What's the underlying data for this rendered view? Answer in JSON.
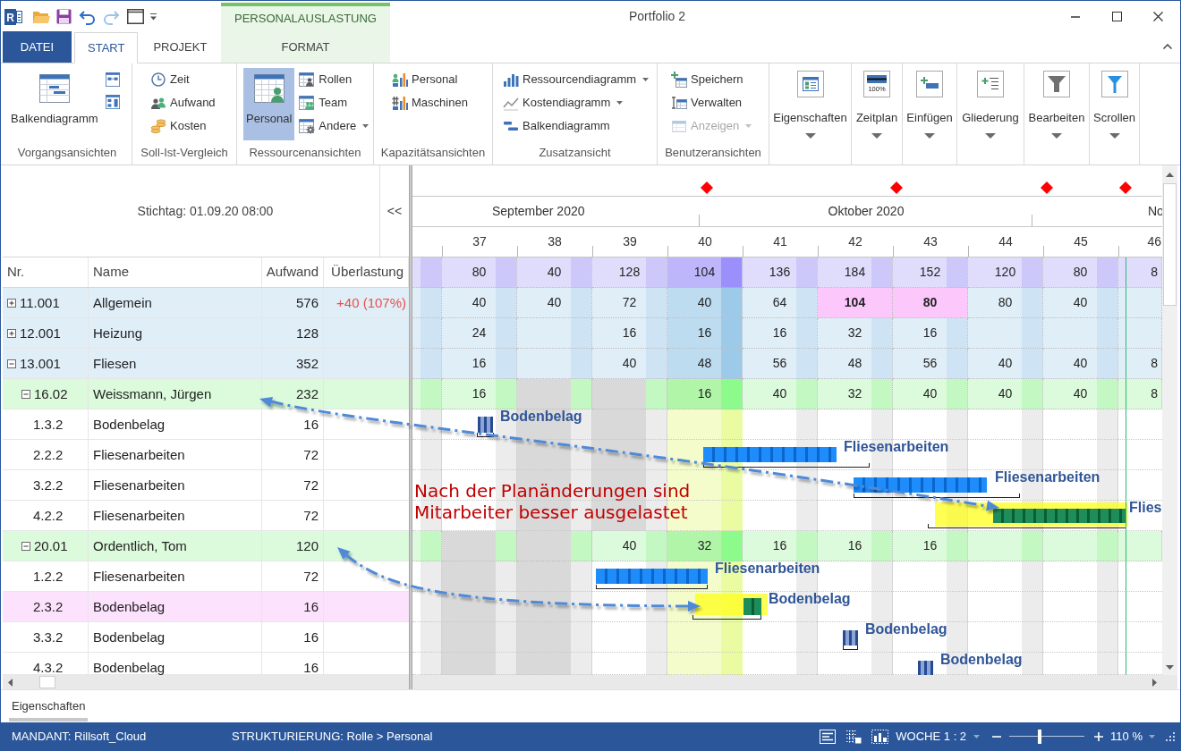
{
  "window": {
    "title": "Portfolio 2",
    "logo_letter": "R"
  },
  "context_tab": {
    "label": "PERSONALAUSLASTUNG"
  },
  "tabs": [
    {
      "label": "DATEI",
      "kind": "file",
      "selected": false
    },
    {
      "label": "START",
      "kind": "tab",
      "selected": true
    },
    {
      "label": "PROJEKT",
      "kind": "tab",
      "selected": false
    },
    {
      "label": "FORMAT",
      "kind": "context",
      "selected": false
    }
  ],
  "ribbon_groups": [
    {
      "label": "Vorgangsansichten",
      "items": [
        {
          "kind": "large",
          "label": "Balkendiagramm",
          "selected": false,
          "disabled": false,
          "dropdown": false
        },
        {
          "kind": "icon",
          "selected": false,
          "disabled": false,
          "dropdown": false
        },
        {
          "kind": "icon",
          "selected": false,
          "disabled": false,
          "dropdown": false
        }
      ]
    },
    {
      "label": "Soll-Ist-Vergleich",
      "items": [
        {
          "kind": "small",
          "label": "Zeit",
          "selected": false,
          "disabled": false,
          "dropdown": false
        },
        {
          "kind": "small",
          "label": "Aufwand",
          "selected": false,
          "disabled": false,
          "dropdown": false
        },
        {
          "kind": "small",
          "label": "Kosten",
          "selected": false,
          "disabled": false,
          "dropdown": false
        }
      ]
    },
    {
      "label": "Ressourcenansichten",
      "items": [
        {
          "kind": "large",
          "label": "Personal",
          "selected": true,
          "disabled": false,
          "dropdown": false
        },
        {
          "kind": "small",
          "label": "Rollen",
          "selected": false,
          "disabled": false,
          "dropdown": false
        },
        {
          "kind": "small",
          "label": "Team",
          "selected": false,
          "disabled": false,
          "dropdown": false
        },
        {
          "kind": "small",
          "label": "Andere",
          "selected": false,
          "disabled": false,
          "dropdown": true
        }
      ]
    },
    {
      "label": "Kapazitätsansichten",
      "items": [
        {
          "kind": "small",
          "label": "Personal",
          "selected": false,
          "disabled": false,
          "dropdown": false
        },
        {
          "kind": "small",
          "label": "Maschinen",
          "selected": false,
          "disabled": false,
          "dropdown": false
        }
      ]
    },
    {
      "label": "Zusatzansicht",
      "items": [
        {
          "kind": "small",
          "label": "Ressourcendiagramm",
          "selected": false,
          "disabled": false,
          "dropdown": true
        },
        {
          "kind": "small",
          "label": "Kostendiagramm",
          "selected": false,
          "disabled": false,
          "dropdown": true
        },
        {
          "kind": "small",
          "label": "Balkendiagramm",
          "selected": false,
          "disabled": false,
          "dropdown": false
        }
      ]
    },
    {
      "label": "Benutzeransichten",
      "items": [
        {
          "kind": "small",
          "label": "Speichern",
          "selected": false,
          "disabled": false,
          "dropdown": false
        },
        {
          "kind": "small",
          "label": "Verwalten",
          "selected": false,
          "disabled": false,
          "dropdown": false
        },
        {
          "kind": "small",
          "label": "Anzeigen",
          "selected": false,
          "disabled": true,
          "dropdown": true
        }
      ]
    }
  ],
  "ribbon_menus": [
    {
      "label": "Eigenschaften"
    },
    {
      "label": "Zeitplan",
      "icon_text": "100%"
    },
    {
      "label": "Einfügen"
    },
    {
      "label": "Gliederung"
    },
    {
      "label": "Bearbeiten"
    },
    {
      "label": "Scrollen"
    }
  ],
  "left_panel": {
    "key_date": "Stichtag: 01.09.20 08:00",
    "collapse_button": "<<"
  },
  "table": {
    "columns": [
      "Nr.",
      "Name",
      "Aufwand",
      "Überlastung"
    ],
    "rows": [
      {
        "kind": "group",
        "nr": "11.001",
        "name": "Allgemein",
        "effort": "576",
        "overload": "+40 (107%)",
        "expanded": false,
        "selected": false,
        "weeks": [
          {
            "hours": "40",
            "overload": false
          },
          {
            "hours": "40",
            "overload": false
          },
          {
            "hours": "72",
            "overload": false
          },
          {
            "hours": "40",
            "overload": false
          },
          {
            "hours": "64",
            "overload": false
          },
          {
            "hours": "104",
            "overload": true
          },
          {
            "hours": "80",
            "overload": true
          },
          {
            "hours": "80",
            "overload": false
          },
          {
            "hours": "40",
            "overload": false
          },
          {
            "overload": false
          }
        ]
      },
      {
        "kind": "group",
        "nr": "12.001",
        "name": "Heizung",
        "effort": "128",
        "expanded": false,
        "selected": false,
        "weeks": [
          {
            "hours": "24",
            "overload": false
          },
          {
            "overload": false
          },
          {
            "hours": "16",
            "overload": false
          },
          {
            "hours": "16",
            "overload": false
          },
          {
            "hours": "16",
            "overload": false
          },
          {
            "hours": "32",
            "overload": false
          },
          {
            "hours": "16",
            "overload": false
          },
          {
            "overload": false
          },
          {
            "overload": false
          },
          {
            "overload": false
          }
        ]
      },
      {
        "kind": "group",
        "nr": "13.001",
        "name": "Fliesen",
        "effort": "352",
        "expanded": true,
        "selected": false,
        "weeks": [
          {
            "hours": "16",
            "overload": false
          },
          {
            "overload": false
          },
          {
            "hours": "40",
            "overload": false
          },
          {
            "hours": "48",
            "overload": false
          },
          {
            "hours": "56",
            "overload": false
          },
          {
            "hours": "48",
            "overload": false
          },
          {
            "hours": "56",
            "overload": false
          },
          {
            "hours": "40",
            "overload": false
          },
          {
            "hours": "40",
            "overload": false
          },
          {
            "hours": "8",
            "overload": false
          }
        ],
        "children": [
          {
            "kind": "person",
            "nr": "16.02",
            "name": "Weissmann, Jürgen",
            "effort": "232",
            "expanded": true,
            "selected": false,
            "weeks": [
              {
                "hours": "16",
                "absent": false
              },
              {
                "absent": true
              },
              {
                "absent": true
              },
              {
                "hours": "16",
                "absent": false
              },
              {
                "hours": "40",
                "absent": false
              },
              {
                "hours": "32",
                "absent": false
              },
              {
                "hours": "40",
                "absent": false
              },
              {
                "hours": "40",
                "absent": false
              },
              {
                "hours": "40",
                "absent": false
              },
              {
                "hours": "8",
                "absent": false
              }
            ],
            "children": [
              {
                "kind": "task",
                "nr": "1.3.2",
                "name": "Bodenbelag",
                "effort": "16",
                "selected": false,
                "bar": {
                  "kind": "small",
                  "label": "Bodenbelag"
                }
              },
              {
                "kind": "task",
                "nr": "2.2.2",
                "name": "Fliesenarbeiten",
                "effort": "72",
                "selected": false,
                "bar": {
                  "kind": "planned",
                  "label": "Fliesenarbeiten"
                }
              },
              {
                "kind": "task",
                "nr": "3.2.2",
                "name": "Fliesenarbeiten",
                "effort": "72",
                "selected": false,
                "bar": {
                  "kind": "planned",
                  "label": "Fliesenarbeiten"
                }
              },
              {
                "kind": "task",
                "nr": "4.2.2",
                "name": "Fliesenarbeiten",
                "effort": "72",
                "selected": false,
                "bar": {
                  "kind": "moved",
                  "label": "Flies"
                }
              }
            ]
          },
          {
            "kind": "person",
            "nr": "20.01",
            "name": "Ordentlich, Tom",
            "effort": "120",
            "expanded": true,
            "selected": false,
            "weeks": [
              {
                "absent": true
              },
              {
                "absent": true
              },
              {
                "hours": "40",
                "absent": false
              },
              {
                "hours": "32",
                "absent": false
              },
              {
                "hours": "16",
                "absent": false
              },
              {
                "hours": "16",
                "absent": false
              },
              {
                "hours": "16",
                "absent": false
              },
              {
                "absent": false
              },
              {
                "absent": false
              },
              {
                "absent": false
              }
            ],
            "children": [
              {
                "kind": "task",
                "nr": "1.2.2",
                "name": "Fliesenarbeiten",
                "effort": "72",
                "selected": false,
                "bar": {
                  "kind": "planned",
                  "label": "Fliesenarbeiten"
                }
              },
              {
                "kind": "task",
                "nr": "2.3.2",
                "name": "Bodenbelag",
                "effort": "16",
                "selected": true,
                "bar": {
                  "kind": "moved",
                  "label": "Bodenbelag"
                }
              },
              {
                "kind": "task",
                "nr": "3.3.2",
                "name": "Bodenbelag",
                "effort": "16",
                "selected": false,
                "bar": {
                  "kind": "small",
                  "label": "Bodenbelag"
                }
              },
              {
                "kind": "task",
                "nr": "4.3.2",
                "name": "Bodenbelag",
                "effort": "16",
                "selected": false,
                "bar": {
                  "kind": "small",
                  "label": "Bodenbelag"
                }
              }
            ]
          }
        ]
      }
    ]
  },
  "timeline": {
    "months": [
      "September 2020",
      "Oktober 2020",
      "No"
    ],
    "weeks": [
      {
        "label": "37",
        "selected": false
      },
      {
        "label": "38",
        "selected": false
      },
      {
        "label": "39",
        "selected": false
      },
      {
        "label": "40",
        "selected": true
      },
      {
        "label": "41",
        "selected": false
      },
      {
        "label": "42",
        "selected": false
      },
      {
        "label": "43",
        "selected": false
      },
      {
        "label": "44",
        "selected": false
      },
      {
        "label": "45",
        "selected": false
      },
      {
        "label": "46",
        "selected": false
      }
    ],
    "totals": [
      "80",
      "40",
      "128",
      "104",
      "136",
      "184",
      "152",
      "120",
      "80",
      "8"
    ]
  },
  "annotation": "Nach der Planänderungen sind\nMitarbeiter besser ausgelastet",
  "bottom_tabs": [
    {
      "label": "Eigenschaften",
      "selected": true
    }
  ],
  "status_bar": {
    "client": "MANDANT: Rillsoft_Cloud",
    "structure": "STRUKTURIERUNG: Rolle > Personal",
    "scale": "WOCHE 1 : 2",
    "zoom": {
      "level": 0.4,
      "reading": "110 %"
    }
  }
}
